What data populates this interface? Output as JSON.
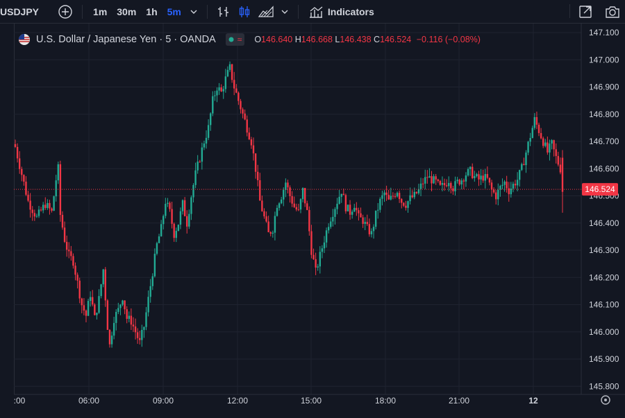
{
  "toolbar": {
    "symbol": "USDJPY",
    "intervals": [
      "1m",
      "30m",
      "1h",
      "5m"
    ],
    "active_interval": "5m",
    "indicators_label": "Indicators"
  },
  "legend": {
    "name": "U.S. Dollar / Japanese Yen · 5 · OANDA",
    "open_label": "O",
    "open": "146.640",
    "high_label": "H",
    "high": "146.668",
    "low_label": "L",
    "low": "146.438",
    "close_label": "C",
    "close": "146.524",
    "change": "−0.116 (−0.08%)"
  },
  "colors": {
    "up": "#22ab94",
    "down": "#f23645",
    "background": "#131722",
    "grid": "#1f2330",
    "price_line": "#f23645"
  },
  "chart_data": {
    "type": "candlestick",
    "title": "U.S. Dollar / Japanese Yen · 5 · OANDA",
    "ylim": [
      145.8,
      147.1
    ],
    "yticks": [
      "147.100",
      "147.000",
      "146.900",
      "146.800",
      "146.700",
      "146.600",
      "146.500",
      "146.400",
      "146.300",
      "146.200",
      "146.100",
      "146.000",
      "145.900",
      "145.800"
    ],
    "xticks": [
      ":00",
      "06:00",
      "09:00",
      "12:00",
      "15:00",
      "18:00",
      "21:00",
      "12"
    ],
    "last_price": "146.524",
    "close_points": [
      [
        0,
        146.68
      ],
      [
        3,
        146.58
      ],
      [
        6,
        146.48
      ],
      [
        10,
        146.42
      ],
      [
        14,
        146.47
      ],
      [
        17,
        146.44
      ],
      [
        19,
        146.56
      ],
      [
        20,
        146.6
      ],
      [
        21,
        146.43
      ],
      [
        23,
        146.34
      ],
      [
        25,
        146.28
      ],
      [
        27,
        146.26
      ],
      [
        29,
        146.18
      ],
      [
        31,
        146.1
      ],
      [
        33,
        146.06
      ],
      [
        35,
        146.14
      ],
      [
        37,
        146.05
      ],
      [
        39,
        146.12
      ],
      [
        41,
        146.23
      ],
      [
        43,
        146.02
      ],
      [
        44,
        145.95
      ],
      [
        46,
        146.05
      ],
      [
        48,
        146.08
      ],
      [
        50,
        146.13
      ],
      [
        52,
        146.05
      ],
      [
        54,
        146.04
      ],
      [
        56,
        146.0
      ],
      [
        58,
        145.96
      ],
      [
        60,
        146.02
      ],
      [
        62,
        146.12
      ],
      [
        64,
        146.22
      ],
      [
        66,
        146.32
      ],
      [
        68,
        146.38
      ],
      [
        70,
        146.48
      ],
      [
        72,
        146.44
      ],
      [
        74,
        146.36
      ],
      [
        76,
        146.4
      ],
      [
        78,
        146.47
      ],
      [
        80,
        146.4
      ],
      [
        82,
        146.5
      ],
      [
        84,
        146.58
      ],
      [
        86,
        146.64
      ],
      [
        88,
        146.7
      ],
      [
        90,
        146.75
      ],
      [
        92,
        146.85
      ],
      [
        94,
        146.9
      ],
      [
        96,
        146.88
      ],
      [
        98,
        146.93
      ],
      [
        100,
        146.97
      ],
      [
        102,
        146.9
      ],
      [
        104,
        146.85
      ],
      [
        106,
        146.8
      ],
      [
        108,
        146.75
      ],
      [
        110,
        146.7
      ],
      [
        112,
        146.6
      ],
      [
        114,
        146.48
      ],
      [
        116,
        146.42
      ],
      [
        118,
        146.36
      ],
      [
        120,
        146.38
      ],
      [
        122,
        146.47
      ],
      [
        124,
        146.5
      ],
      [
        126,
        146.55
      ],
      [
        128,
        146.5
      ],
      [
        130,
        146.46
      ],
      [
        132,
        146.44
      ],
      [
        134,
        146.52
      ],
      [
        136,
        146.44
      ],
      [
        138,
        146.3
      ],
      [
        140,
        146.22
      ],
      [
        142,
        146.28
      ],
      [
        144,
        146.34
      ],
      [
        146,
        146.4
      ],
      [
        148,
        146.44
      ],
      [
        150,
        146.48
      ],
      [
        152,
        146.52
      ],
      [
        154,
        146.46
      ],
      [
        156,
        146.44
      ],
      [
        158,
        146.47
      ],
      [
        160,
        146.42
      ],
      [
        162,
        146.41
      ],
      [
        164,
        146.38
      ],
      [
        166,
        146.36
      ],
      [
        168,
        146.43
      ],
      [
        170,
        146.48
      ],
      [
        172,
        146.51
      ],
      [
        174,
        146.48
      ],
      [
        176,
        146.5
      ],
      [
        178,
        146.52
      ],
      [
        180,
        146.48
      ],
      [
        182,
        146.47
      ],
      [
        184,
        146.49
      ],
      [
        186,
        146.5
      ],
      [
        188,
        146.52
      ],
      [
        190,
        146.55
      ],
      [
        192,
        146.57
      ],
      [
        194,
        146.56
      ],
      [
        196,
        146.55
      ],
      [
        198,
        146.53
      ],
      [
        200,
        146.54
      ],
      [
        202,
        146.56
      ],
      [
        204,
        146.53
      ],
      [
        206,
        146.55
      ],
      [
        208,
        146.56
      ],
      [
        210,
        146.58
      ],
      [
        212,
        146.59
      ],
      [
        214,
        146.57
      ],
      [
        216,
        146.56
      ],
      [
        218,
        146.57
      ],
      [
        220,
        146.56
      ],
      [
        222,
        146.52
      ],
      [
        224,
        146.5
      ],
      [
        226,
        146.53
      ],
      [
        228,
        146.55
      ],
      [
        230,
        146.52
      ],
      [
        232,
        146.54
      ],
      [
        234,
        146.56
      ],
      [
        236,
        146.6
      ],
      [
        238,
        146.66
      ],
      [
        240,
        146.72
      ],
      [
        242,
        146.78
      ],
      [
        244,
        146.74
      ],
      [
        246,
        146.7
      ],
      [
        248,
        146.66
      ],
      [
        250,
        146.69
      ],
      [
        252,
        146.64
      ],
      [
        254,
        146.6
      ],
      [
        255,
        146.52
      ]
    ]
  }
}
